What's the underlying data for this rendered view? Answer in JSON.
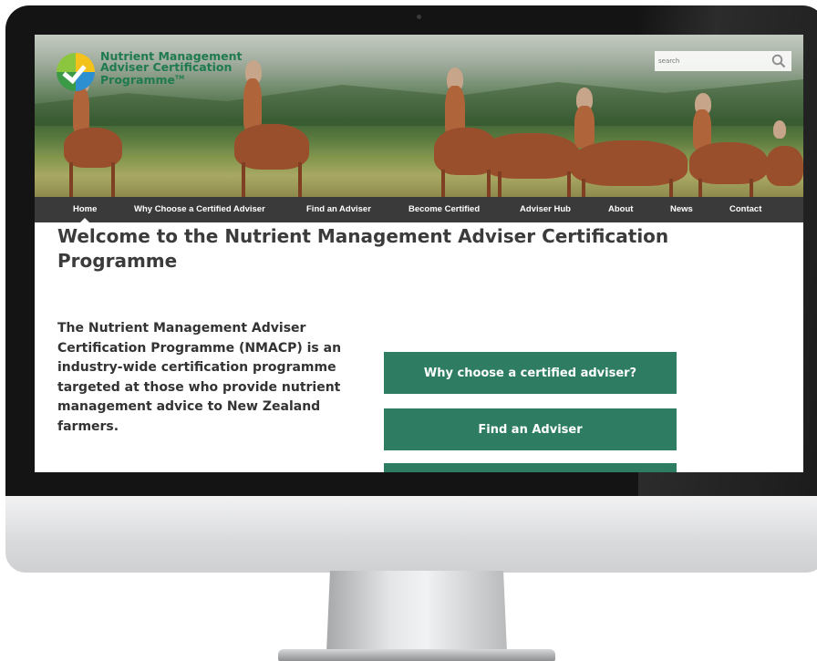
{
  "site": {
    "logo_lines": [
      "Nutrient Management",
      "Adviser Certification",
      "Programme"
    ],
    "logo_tm": "TM"
  },
  "search": {
    "placeholder": "search"
  },
  "nav": {
    "items": [
      {
        "label": "Home",
        "active": true
      },
      {
        "label": "Why Choose a Certified Adviser"
      },
      {
        "label": "Find an Adviser"
      },
      {
        "label": "Become Certified"
      },
      {
        "label": "Adviser Hub"
      },
      {
        "label": "About"
      },
      {
        "label": "News"
      },
      {
        "label": "Contact"
      }
    ]
  },
  "main": {
    "title": "Welcome to the Nutrient Management Adviser Certification Programme",
    "intro": "The Nutrient Management Adviser Certification Programme (NMACP) is an industry-wide certification programme targeted at those who provide nutrient management advice to New Zealand farmers.",
    "cta_buttons": [
      {
        "label": "Why choose a certified adviser?"
      },
      {
        "label": "Find an Adviser"
      },
      {
        "label": ""
      }
    ]
  },
  "colors": {
    "accent_green": "#2e7d62",
    "nav_background": "#3a3a3a",
    "logo_green": "#1f7a4f"
  }
}
